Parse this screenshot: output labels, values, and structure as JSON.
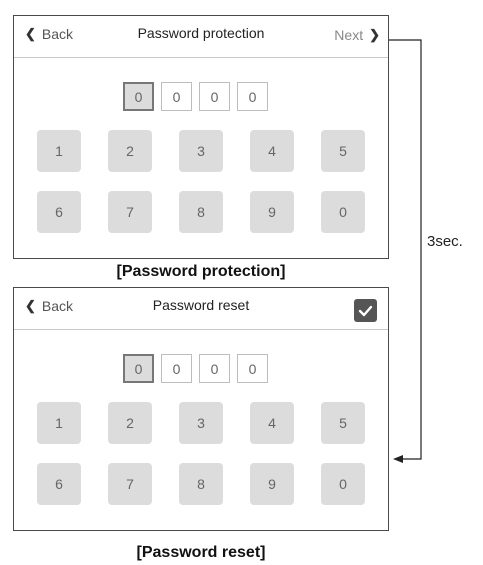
{
  "protection_panel": {
    "back_label": "Back",
    "title": "Password protection",
    "next_label": "Next",
    "digits": [
      "0",
      "0",
      "0",
      "0"
    ],
    "keys_row1": [
      "1",
      "2",
      "3",
      "4",
      "5"
    ],
    "keys_row2": [
      "6",
      "7",
      "8",
      "9",
      "0"
    ],
    "caption": "[Password protection]"
  },
  "reset_panel": {
    "back_label": "Back",
    "title": "Password reset",
    "confirm_icon": "check-icon",
    "digits": [
      "0",
      "0",
      "0",
      "0"
    ],
    "keys_row1": [
      "1",
      "2",
      "3",
      "4",
      "5"
    ],
    "keys_row2": [
      "6",
      "7",
      "8",
      "9",
      "0"
    ],
    "caption": "[Password reset]"
  },
  "transition_label": "3sec."
}
